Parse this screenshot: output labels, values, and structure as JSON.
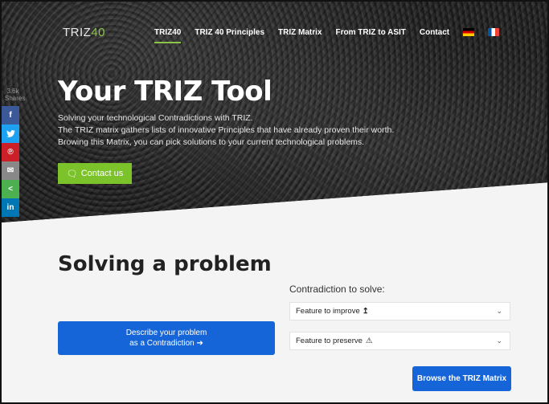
{
  "nav": {
    "logo_main": "TRIZ",
    "logo_accent": "40",
    "links": [
      {
        "label": "TRIZ40",
        "active": true
      },
      {
        "label": "TRIZ 40 Principles"
      },
      {
        "label": "TRIZ Matrix"
      },
      {
        "label": "From TRIZ to ASIT"
      },
      {
        "label": "Contact"
      }
    ]
  },
  "hero": {
    "title": "Your TRIZ Tool",
    "lines": [
      "Solving your technological Contradictions with TRIZ.",
      "The TRIZ matrix gathers lists of innovative Principles that have already proven their worth.",
      "Browing this Matrix, you can pick solutions to your current technological problems."
    ],
    "contact_button": "Contact us"
  },
  "share": {
    "count": "3.6k",
    "count_label": "Shares"
  },
  "main": {
    "section_title": "Solving a problem",
    "contradiction_label": "Contradiction to solve:",
    "improve_select": "Feature to improve",
    "preserve_select": "Feature to preserve",
    "describe_line1": "Describe your problem",
    "describe_line2": "as a Contradiction",
    "browse_button": "Browse the TRIZ Matrix"
  },
  "colors": {
    "accent_green": "#7cc22b",
    "primary_blue": "#1565d8"
  }
}
